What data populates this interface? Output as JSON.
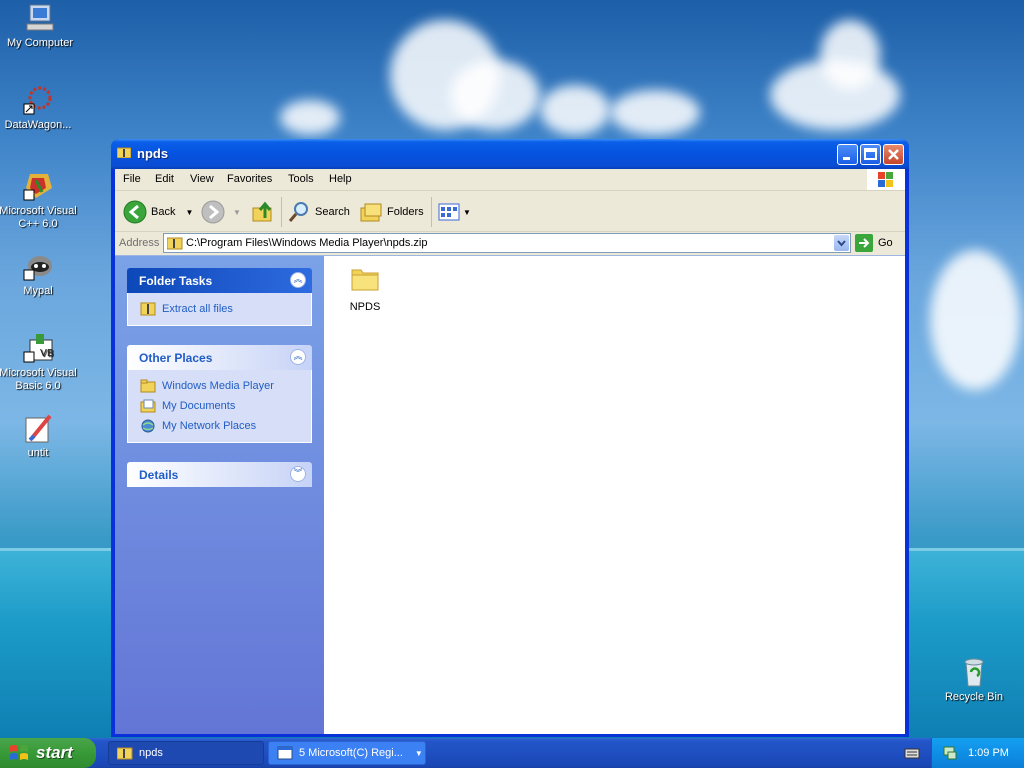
{
  "desktop": {
    "icons": [
      {
        "label": "My Computer"
      },
      {
        "label": "DataWagon..."
      },
      {
        "label": "Microsoft Visual C++ 6.0"
      },
      {
        "label": "Mypal"
      },
      {
        "label": "Microsoft Visual Basic 6.0"
      },
      {
        "label": "untit"
      },
      {
        "label": "Recycle Bin"
      }
    ]
  },
  "window": {
    "title": "npds",
    "menu": [
      "File",
      "Edit",
      "View",
      "Favorites",
      "Tools",
      "Help"
    ],
    "toolbar": {
      "back": "Back",
      "search": "Search",
      "folders": "Folders"
    },
    "address": {
      "label": "Address",
      "value": "C:\\Program Files\\Windows Media Player\\npds.zip",
      "go": "Go"
    },
    "taskpane": {
      "folder_tasks": {
        "title": "Folder Tasks",
        "items": [
          "Extract all files"
        ]
      },
      "other_places": {
        "title": "Other Places",
        "items": [
          "Windows Media Player",
          "My Documents",
          "My Network Places"
        ]
      },
      "details": {
        "title": "Details"
      }
    },
    "files": [
      {
        "name": "NPDS"
      }
    ]
  },
  "taskbar": {
    "start": "start",
    "tasks": [
      {
        "label": "npds"
      },
      {
        "label": "5 Microsoft(C) Regi..."
      }
    ],
    "clock": "1:09 PM"
  }
}
